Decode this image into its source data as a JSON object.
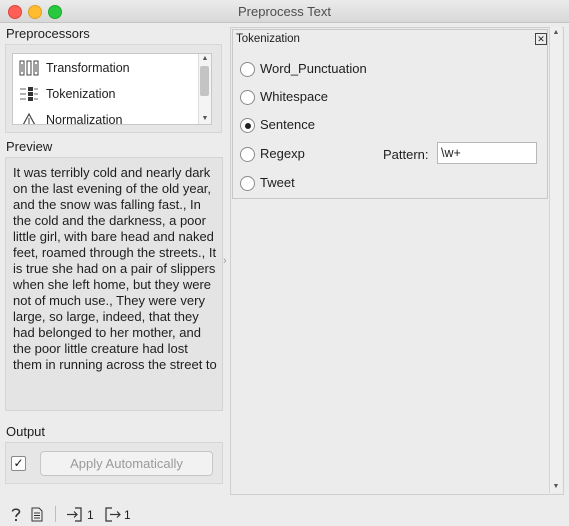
{
  "window": {
    "title": "Preprocess Text"
  },
  "preprocessors": {
    "label": "Preprocessors",
    "items": [
      {
        "label": "Transformation",
        "icon": "transformation-icon"
      },
      {
        "label": "Tokenization",
        "icon": "tokenization-icon"
      },
      {
        "label": "Normalization",
        "icon": "normalization-icon"
      }
    ]
  },
  "preview": {
    "label": "Preview",
    "text": "It was terribly cold and nearly dark on the last evening of the old year, and the snow was falling fast., In the cold and the darkness, a poor little girl, with bare head and naked feet, roamed through the streets., It is true she had on a pair of slippers when she left home, but they were not of much use., They were very large, so large, indeed, that they had belonged to her mother, and the poor little creature had lost them in running across the street to"
  },
  "output": {
    "label": "Output",
    "auto_checked": "✓",
    "apply_label": "Apply Automatically"
  },
  "tokenization": {
    "title": "Tokenization",
    "options": [
      "Word_Punctuation",
      "Whitespace",
      "Sentence",
      "Regexp",
      "Tweet"
    ],
    "selected": "Sentence",
    "pattern_label": "Pattern:",
    "pattern_value": "\\w+"
  },
  "status": {
    "input_count": "1",
    "output_count": "1"
  },
  "colors": {
    "close": "#ff5f57",
    "minimize": "#febc2e",
    "maximize": "#28c840"
  }
}
